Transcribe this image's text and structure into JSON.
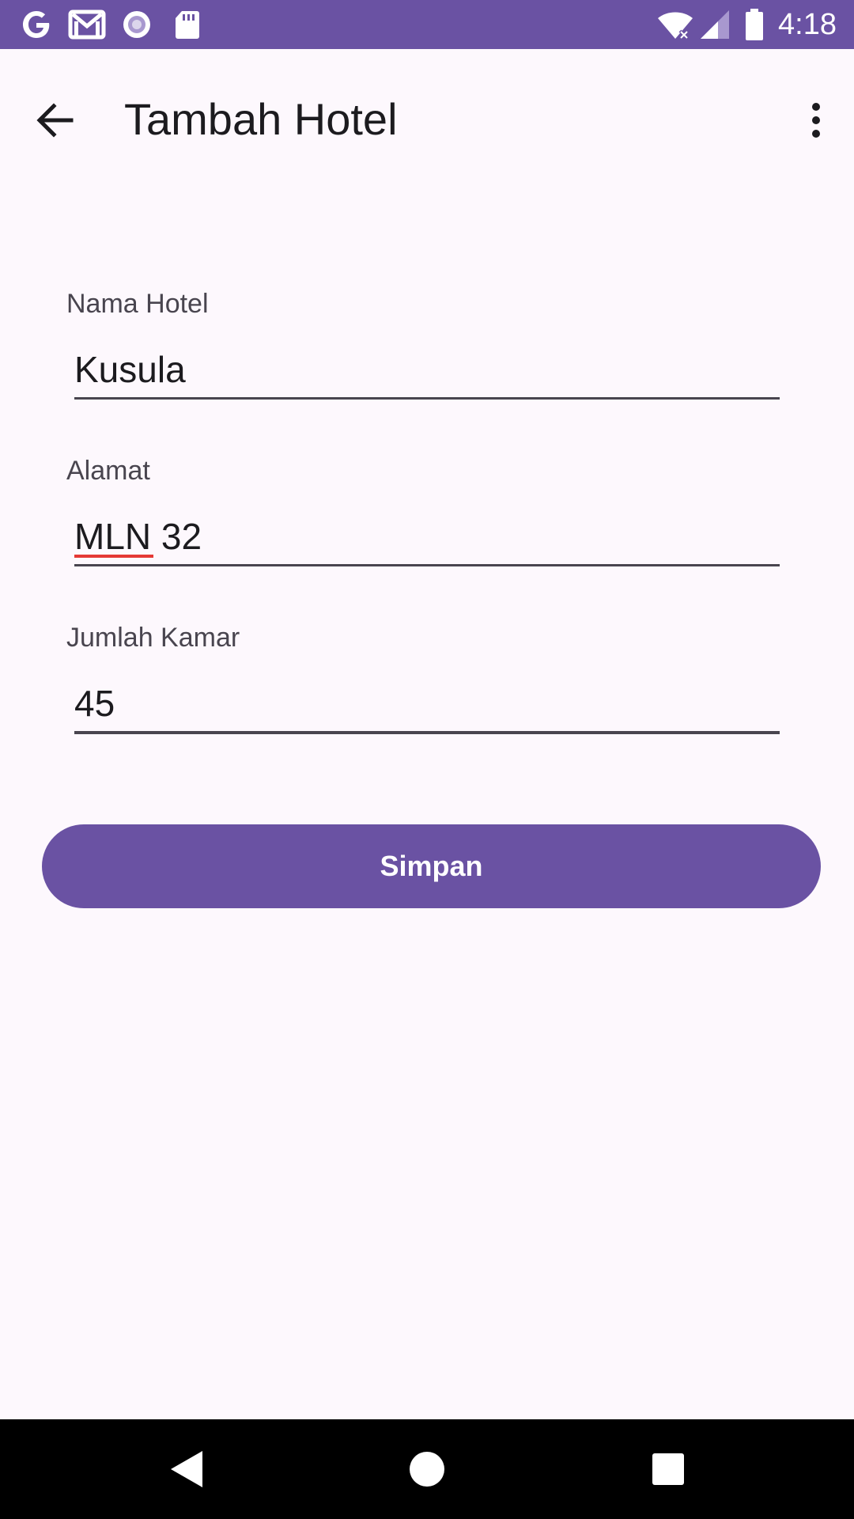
{
  "status_bar": {
    "time": "4:18",
    "icons": [
      "google-icon",
      "gmail-icon",
      "media-icon",
      "sd-card-icon",
      "wifi-icon",
      "signal-icon",
      "battery-icon"
    ]
  },
  "app_bar": {
    "title": "Tambah Hotel",
    "back_icon": "arrow-back-icon",
    "overflow_icon": "more-vert-icon"
  },
  "form": {
    "fields": [
      {
        "label": "Nama Hotel",
        "value": "Kusula"
      },
      {
        "label": "Alamat",
        "value": "MLN 32"
      },
      {
        "label": "Jumlah Kamar",
        "value": "45"
      }
    ],
    "submit_label": "Simpan"
  },
  "colors": {
    "primary": "#6a52a3",
    "background": "#fdf8fd",
    "text": "#1c1b1f",
    "label": "#49454f",
    "spellcheck": "#e53935"
  },
  "nav_bar": {
    "icons": [
      "nav-back-icon",
      "nav-home-icon",
      "nav-recents-icon"
    ]
  }
}
